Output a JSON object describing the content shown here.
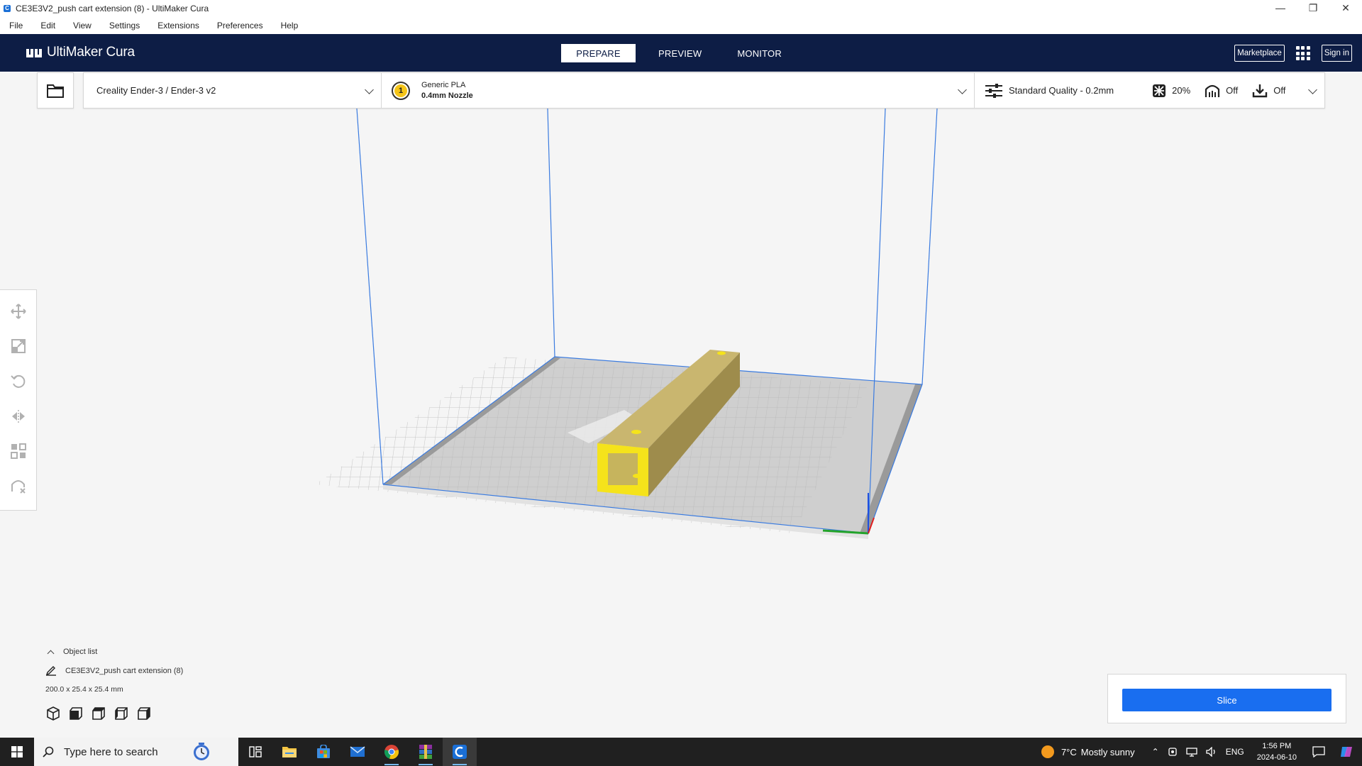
{
  "window": {
    "title": "CE3E3V2_push cart extension (8) - UltiMaker Cura",
    "app_icon": "C"
  },
  "menu": [
    "File",
    "Edit",
    "View",
    "Settings",
    "Extensions",
    "Preferences",
    "Help"
  ],
  "header": {
    "logo_text": "UltiMaker Cura",
    "tabs": [
      {
        "label": "PREPARE",
        "active": true
      },
      {
        "label": "PREVIEW",
        "active": false
      },
      {
        "label": "MONITOR",
        "active": false
      }
    ],
    "marketplace_label": "Marketplace",
    "signin_label": "Sign in"
  },
  "printer": {
    "name": "Creality Ender-3 / Ender-3 v2"
  },
  "material": {
    "extruder_number": "1",
    "name": "Generic PLA",
    "nozzle": "0.4mm Nozzle",
    "badge_color": "#f5c518"
  },
  "print_settings": {
    "quality": "Standard Quality - 0.2mm",
    "infill": "20%",
    "support": "Off",
    "adhesion": "Off"
  },
  "object_list": {
    "toggle_label": "Object list",
    "object_name": "CE3E3V2_push cart extension (8)",
    "dimensions": "200.0 x 25.4 x 25.4 mm"
  },
  "slice": {
    "button_label": "Slice",
    "accent": "#196ef0"
  },
  "taskbar": {
    "search_placeholder": "Type here to search",
    "weather_temp": "7°C",
    "weather_desc": "Mostly sunny",
    "language": "ENG",
    "time": "1:56 PM",
    "date": "2024-06-10"
  },
  "colors": {
    "header_bg": "#0d1d45",
    "model_color": "#b8a868",
    "model_highlight": "#f5e31b"
  }
}
